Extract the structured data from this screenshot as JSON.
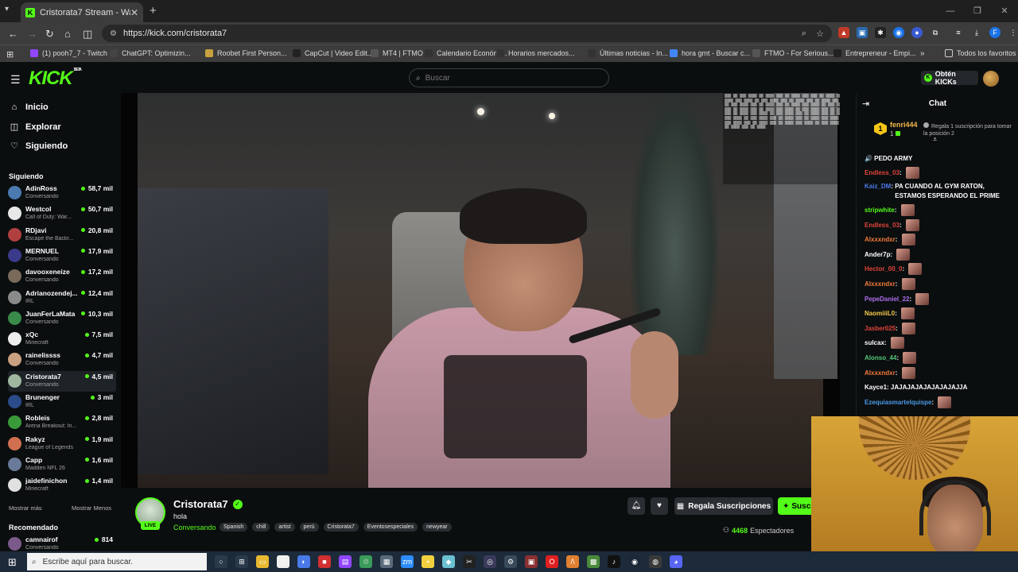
{
  "browser": {
    "tab_title": "Cristorata7 Stream - Watch Live",
    "tab_favicon": "K",
    "url": "https://kick.com/cristorata7",
    "bookmarks": [
      {
        "label": "(1) pooh7_7 - Twitch",
        "icon": "twitch-icon",
        "color": "#9146ff"
      },
      {
        "label": "ChatGPT: Optimizin...",
        "icon": "chatgpt-icon",
        "color": "#444"
      },
      {
        "label": "Roobet First Person...",
        "icon": "roobet-icon",
        "color": "#c8a040"
      },
      {
        "label": "CapCut | Video Edit...",
        "icon": "capcut-icon",
        "color": "#222"
      },
      {
        "label": "MT4 | FTMO",
        "icon": "ftmo-icon",
        "color": "#555"
      },
      {
        "label": "Calendario Económi...",
        "icon": "investing-icon",
        "color": "#333"
      },
      {
        "label": "Horarios mercados...",
        "icon": "investing-icon",
        "color": "#333"
      },
      {
        "label": "Últimas noticias - In...",
        "icon": "investing-icon",
        "color": "#333"
      },
      {
        "label": "hora gmt - Buscar c...",
        "icon": "google-icon",
        "color": "#4285f4"
      },
      {
        "label": "FTMO - For Serious...",
        "icon": "ftmo-icon",
        "color": "#555"
      },
      {
        "label": "Entrepreneur - Empi...",
        "icon": "entrepreneur-icon",
        "color": "#222"
      }
    ],
    "all_favorites": "Todos los favoritos"
  },
  "kick": {
    "logo_text": "KICK",
    "beta": "BETA",
    "search_placeholder": "Buscar",
    "get_kicks": "Obtén KICKs",
    "accent": "#53fc18"
  },
  "sidebar": {
    "nav": [
      {
        "label": "Inicio",
        "icon": "home-icon",
        "glyph": "⌂"
      },
      {
        "label": "Explorar",
        "icon": "compass-icon",
        "glyph": "◫"
      },
      {
        "label": "Siguiendo",
        "icon": "heart-icon",
        "glyph": "♡"
      }
    ],
    "following_title": "Siguiendo",
    "following": [
      {
        "name": "AdinRoss",
        "category": "Conversando",
        "viewers": "58,7 mil",
        "color": "#4a7ab0"
      },
      {
        "name": "Westcol",
        "category": "Call of Duty: War...",
        "viewers": "50,7 mil",
        "color": "#e8e8e8"
      },
      {
        "name": "RDjavi",
        "category": "Escape the Backr...",
        "viewers": "20,8 mil",
        "color": "#b04040"
      },
      {
        "name": "MERNUEL",
        "category": "Conversando",
        "viewers": "17,9 mil",
        "color": "#3a3a8a"
      },
      {
        "name": "davooxeneize",
        "category": "Conversando",
        "viewers": "17,2 mil",
        "color": "#7a6a5a"
      },
      {
        "name": "Adrianozendej...",
        "category": "IRL",
        "viewers": "12,4 mil",
        "color": "#8a8a8a"
      },
      {
        "name": "JuanFerLaMata",
        "category": "Conversando",
        "viewers": "10,3 mil",
        "color": "#3a8a4a"
      },
      {
        "name": "xQc",
        "category": "Minecraft",
        "viewers": "7,5 mil",
        "color": "#eeeeee"
      },
      {
        "name": "rainelissss",
        "category": "Conversando",
        "viewers": "4,7 mil",
        "color": "#caa080"
      },
      {
        "name": "Cristorata7",
        "category": "Conversando",
        "viewers": "4,5 mil",
        "color": "#a0b8a0",
        "selected": true
      },
      {
        "name": "Brunenger",
        "category": "IRL",
        "viewers": "3 mil",
        "color": "#2a4a8a"
      },
      {
        "name": "Robleis",
        "category": "Arena Breakout: In...",
        "viewers": "2,8 mil",
        "color": "#3a9a3a"
      },
      {
        "name": "Rakyz",
        "category": "League of Legends",
        "viewers": "1,9 mil",
        "color": "#d07050"
      },
      {
        "name": "Capp",
        "category": "Madden NFL 26",
        "viewers": "1,6 mil",
        "color": "#6a7a9a"
      },
      {
        "name": "jaidefinichon",
        "category": "Minecraft",
        "viewers": "1,4 mil",
        "color": "#e0e0e0"
      }
    ],
    "show_more": "Mostrar más",
    "show_less": "Mostrar Menos",
    "recommended_title": "Recomendado",
    "recommended": [
      {
        "name": "camnairof",
        "category": "Conversando",
        "viewers": "814",
        "color": "#7a5a8a"
      }
    ]
  },
  "channel": {
    "name": "Cristorata7",
    "live": "LIVE",
    "title": "hola",
    "category": "Conversando",
    "tags": [
      "Spanish",
      "chill",
      "artist",
      "perú",
      "Cristorata7",
      "Eventosespeciales",
      "newyear"
    ],
    "gift_button": "Regala Suscripciones",
    "subscribe_button": "Suscribirse",
    "viewers_count": "4468",
    "viewers_label": "Espectadores"
  },
  "chat": {
    "title": "Chat",
    "pinned": {
      "rank": "1",
      "user": "fenri444",
      "count": "1",
      "text": "Regala 1 suscripción para tomar la posición 2"
    },
    "messages": [
      {
        "user": "",
        "text": "🔊 PEDO ARMY",
        "color": "#ffffff",
        "emote": false
      },
      {
        "user": "Endless_03",
        "text": "",
        "color": "#e0443a",
        "emote": true
      },
      {
        "user": "Kaiz_DM",
        "text": "PA CUANDO AL GYM RATON, ESTAMOS ESPERANDO EL PRIME",
        "color": "#4a7ae8",
        "emote": false,
        "tall": true
      },
      {
        "user": "stripwhite",
        "text": "",
        "color": "#53fc18",
        "emote": true
      },
      {
        "user": "Endless_03",
        "text": "",
        "color": "#e0443a",
        "emote": true
      },
      {
        "user": "Alxxxndxr",
        "text": "",
        "color": "#f27a3a",
        "emote": true
      },
      {
        "user": "Ander7p",
        "text": "",
        "color": "#ffffff",
        "emote": true
      },
      {
        "user": "Hector_00_0",
        "text": "",
        "color": "#e0443a",
        "emote": true
      },
      {
        "user": "Alxxxndxr",
        "text": "",
        "color": "#f27a3a",
        "emote": true
      },
      {
        "user": "PepeDaniel_22",
        "text": "",
        "color": "#b070f0",
        "emote": true
      },
      {
        "user": "NaomiiiL0",
        "text": "",
        "color": "#f2c94b",
        "emote": true
      },
      {
        "user": "Jasber025",
        "text": "",
        "color": "#e0443a",
        "emote": true
      },
      {
        "user": "sulcax",
        "text": "",
        "color": "#ffffff",
        "emote": true
      },
      {
        "user": "Alonso_44",
        "text": "",
        "color": "#53c878",
        "emote": true
      },
      {
        "user": "Alxxxndxr",
        "text": "",
        "color": "#f27a3a",
        "emote": true
      },
      {
        "user": "Kayce1",
        "text": "JAJAJAJAJAJAJAJAJJA",
        "color": "#ffffff",
        "emote": false
      },
      {
        "user": "Ezequiasmartelquispe",
        "text": "",
        "color": "#4a9ae8",
        "emote": true
      }
    ]
  },
  "taskbar": {
    "search_placeholder": "Escribe aquí para buscar.",
    "apps": [
      {
        "icon": "task-view-icon",
        "color": "#2a3a4a",
        "glyph": "○"
      },
      {
        "icon": "widgets-icon",
        "color": "#2a3a4a",
        "glyph": "⊞"
      },
      {
        "icon": "folder-icon",
        "color": "#e8b830",
        "glyph": "▭"
      },
      {
        "icon": "file-icon",
        "color": "#f0f0f0",
        "glyph": "▯"
      },
      {
        "icon": "copilot-icon",
        "color": "#4a7ae8",
        "glyph": "◐"
      },
      {
        "icon": "red-app-icon",
        "color": "#d03030",
        "glyph": "■"
      },
      {
        "icon": "twitch-icon",
        "color": "#9146ff",
        "glyph": "▤"
      },
      {
        "icon": "recycle-icon",
        "color": "#3a9a5a",
        "glyph": "♲"
      },
      {
        "icon": "app-icon",
        "color": "#5a6a7a",
        "glyph": "▦"
      },
      {
        "icon": "zoom-icon",
        "color": "#2d8cff",
        "glyph": "zm"
      },
      {
        "icon": "notes-icon",
        "color": "#f0d040",
        "glyph": "▪"
      },
      {
        "icon": "app-icon",
        "color": "#6ac0d0",
        "glyph": "◆"
      },
      {
        "icon": "capcut-icon",
        "color": "#222222",
        "glyph": "✂"
      },
      {
        "icon": "obs-icon",
        "color": "#3a3a5a",
        "glyph": "◎"
      },
      {
        "icon": "settings-icon",
        "color": "#3a4a5a",
        "glyph": "⚙"
      },
      {
        "icon": "app-icon",
        "color": "#8a3030",
        "glyph": "▣"
      },
      {
        "icon": "opera-icon",
        "color": "#e02020",
        "glyph": "O"
      },
      {
        "icon": "app-icon",
        "color": "#e08030",
        "glyph": "/\\"
      },
      {
        "icon": "minecraft-icon",
        "color": "#4a8a3a",
        "glyph": "▩"
      },
      {
        "icon": "tiktok-icon",
        "color": "#111111",
        "glyph": "♪"
      },
      {
        "icon": "steam-icon",
        "color": "#1b2838",
        "glyph": "◉"
      },
      {
        "icon": "app-icon",
        "color": "#3a3a3a",
        "glyph": "◍"
      },
      {
        "icon": "discord-icon",
        "color": "#5865f2",
        "glyph": "◕"
      }
    ]
  }
}
